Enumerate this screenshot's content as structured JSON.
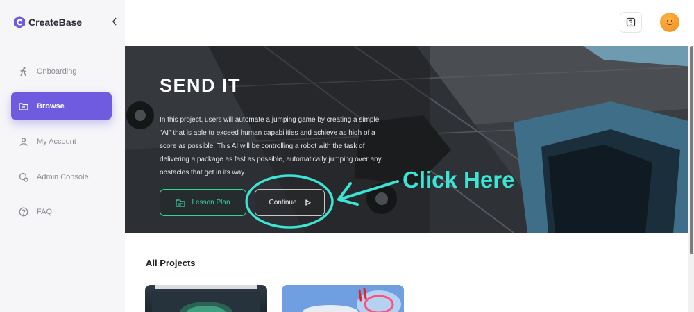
{
  "app": {
    "name": "CreateBase"
  },
  "sidebar": {
    "collapse_icon": "chevron-left-icon",
    "items": [
      {
        "label": "Onboarding",
        "icon": "walking-person-icon",
        "active": false
      },
      {
        "label": "Browse",
        "icon": "folder-icon",
        "active": true
      },
      {
        "label": "My Account",
        "icon": "user-icon",
        "active": false
      },
      {
        "label": "Admin Console",
        "icon": "admin-icon",
        "active": false
      },
      {
        "label": "FAQ",
        "icon": "question-circle-icon",
        "active": false
      }
    ]
  },
  "topbar": {
    "help_icon": "help-icon",
    "avatar_icon": "avatar-face"
  },
  "hero": {
    "title": "SEND IT",
    "description": "In this project, users will automate a jumping game by creating a simple \"AI\" that is able to exceed human capabilities and achieve as high of a score as possible. This AI will be controlling a robot with the task of delivering a package as fast as possible, automatically jumping over any obstacles that get in its way.",
    "lesson_plan_label": "Lesson Plan",
    "continue_label": "Continue",
    "annotation_text": "Click Here"
  },
  "projects": {
    "title": "All Projects"
  },
  "colors": {
    "accent": "#6f5be0",
    "lesson_green": "#35d497",
    "annotation_cyan": "#3de3d3",
    "sidebar_bg": "#f6f6f8"
  }
}
